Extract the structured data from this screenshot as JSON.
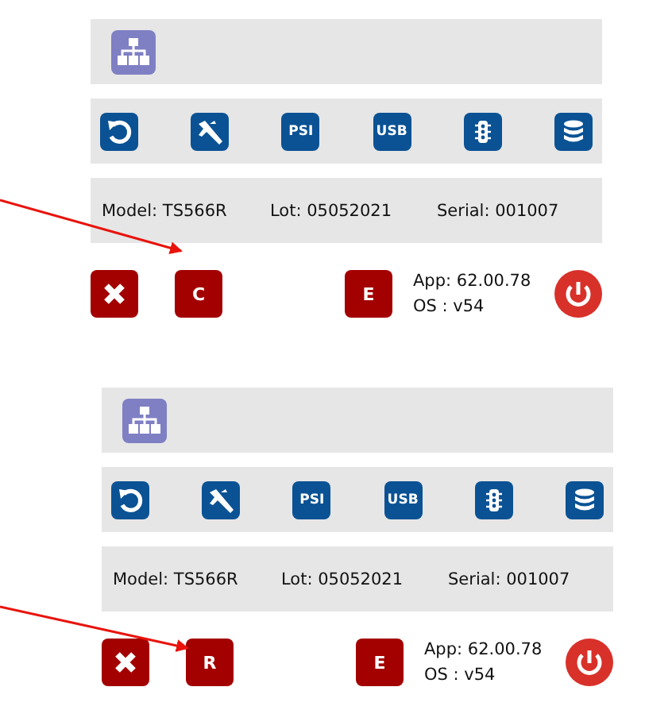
{
  "panels": [
    {
      "toolbar": [
        {
          "kind": "reset"
        },
        {
          "kind": "caliper"
        },
        {
          "kind": "text",
          "label": "PSI"
        },
        {
          "kind": "text",
          "label": "USB"
        },
        {
          "kind": "traffic"
        },
        {
          "kind": "database"
        }
      ],
      "info": [
        "Model: TS566R",
        "Lot: 05052021",
        "Serial: 001007"
      ],
      "actions": [
        {
          "kind": "close"
        },
        {
          "kind": "text",
          "label": "C"
        },
        {
          "kind": "text",
          "label": "E"
        }
      ],
      "app": "App: 62.00.78",
      "os": "OS : v54"
    },
    {
      "toolbar": [
        {
          "kind": "reset"
        },
        {
          "kind": "caliper"
        },
        {
          "kind": "text",
          "label": "PSI"
        },
        {
          "kind": "text",
          "label": "USB"
        },
        {
          "kind": "traffic"
        },
        {
          "kind": "database"
        }
      ],
      "info": [
        "Model: TS566R",
        "Lot: 05052021",
        "Serial: 001007"
      ],
      "actions": [
        {
          "kind": "close"
        },
        {
          "kind": "text",
          "label": "R"
        },
        {
          "kind": "text",
          "label": "E"
        }
      ],
      "app": "App: 62.00.78",
      "os": "OS : v54"
    }
  ]
}
